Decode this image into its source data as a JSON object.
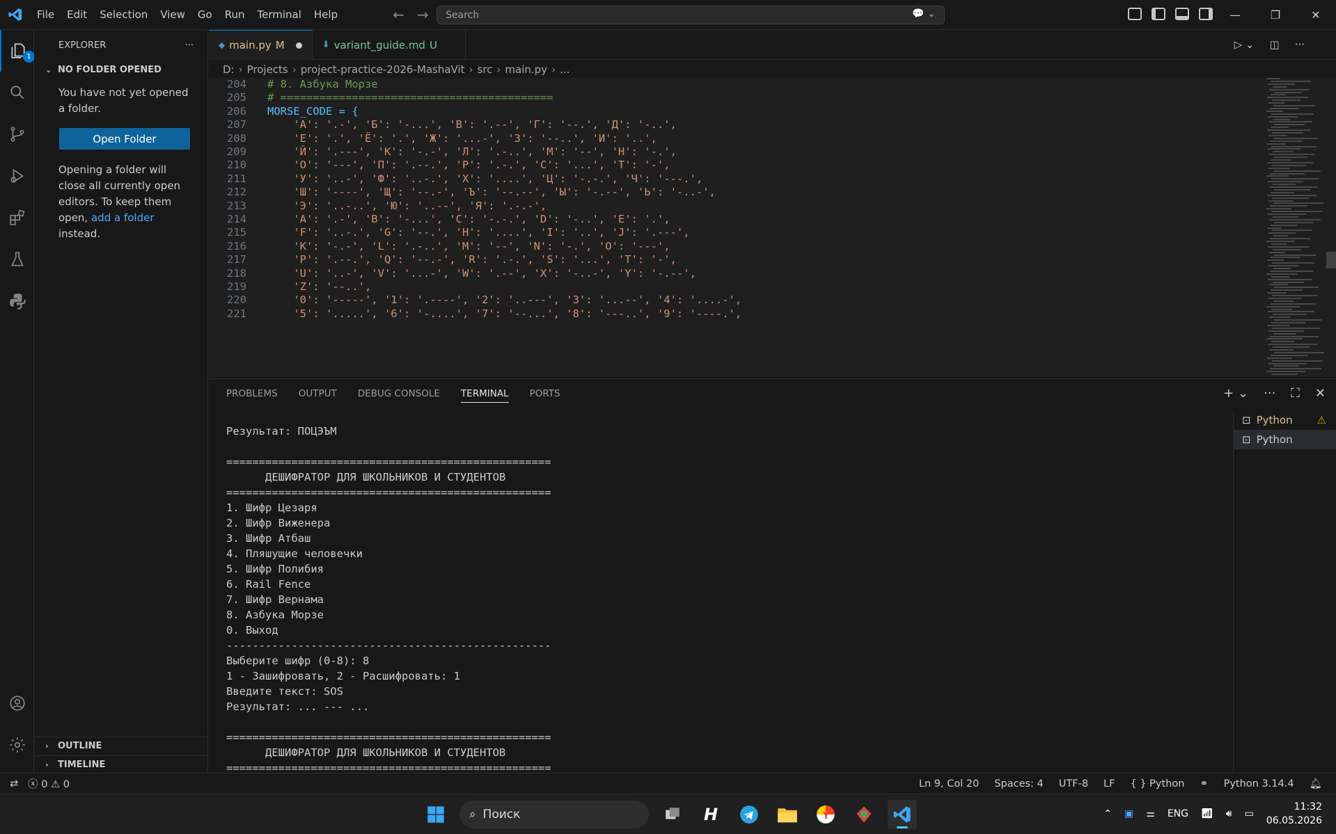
{
  "menu": [
    "File",
    "Edit",
    "Selection",
    "View",
    "Go",
    "Run",
    "Terminal",
    "Help"
  ],
  "search": {
    "placeholder": "Search"
  },
  "activity": {
    "explorer_badge": "1"
  },
  "sidebar": {
    "title": "EXPLORER",
    "section": "NO FOLDER OPENED",
    "message": "You have not yet opened a folder.",
    "open_folder": "Open Folder",
    "hint_1": "Opening a folder will close all currently open editors. To keep them open, ",
    "hint_link": "add a folder",
    "hint_2": " instead.",
    "outline": "OUTLINE",
    "timeline": "TIMELINE"
  },
  "tabs": [
    {
      "label": "main.py",
      "status": "M"
    },
    {
      "label": "variant_guide.md",
      "status": "U"
    }
  ],
  "breadcrumb": [
    "D:",
    "Projects",
    "project-practice-2026-MashaVit",
    "src",
    "main.py",
    "..."
  ],
  "code": [
    {
      "n": "204",
      "t": "# 8. Азбука Морзе",
      "k": "comment"
    },
    {
      "n": "205",
      "t": "# ==========================================",
      "k": "comment"
    },
    {
      "n": "206",
      "t": "MORSE_CODE = {",
      "k": "decl"
    },
    {
      "n": "207",
      "t": "    'А': '.-', 'Б': '-...', 'В': '.--', 'Г': '--.', 'Д': '-..',",
      "k": "str"
    },
    {
      "n": "208",
      "t": "    'Е': '.', 'Ё': '.', 'Ж': '...-', 'З': '--..', 'И': '..',",
      "k": "str"
    },
    {
      "n": "209",
      "t": "    'Й': '.---', 'К': '-.-', 'Л': '.-..', 'М': '--', 'Н': '-.',",
      "k": "str"
    },
    {
      "n": "210",
      "t": "    'О': '---', 'П': '.--.', 'Р': '.-.', 'С': '...', 'Т': '-',",
      "k": "str"
    },
    {
      "n": "211",
      "t": "    'У': '..-', 'Ф': '..-.', 'Х': '....', 'Ц': '-.-.', 'Ч': '---.',",
      "k": "str"
    },
    {
      "n": "212",
      "t": "    'Ш': '----', 'Щ': '--.-', 'Ъ': '--.--', 'Ы': '-.--', 'Ь': '-..-',",
      "k": "str"
    },
    {
      "n": "213",
      "t": "    'Э': '..-..', 'Ю': '..--', 'Я': '.-.-',",
      "k": "str"
    },
    {
      "n": "214",
      "t": "    'A': '.-', 'B': '-...', 'C': '-.-.', 'D': '-..', 'E': '.',",
      "k": "str"
    },
    {
      "n": "215",
      "t": "    'F': '..-.', 'G': '--.', 'H': '....', 'I': '..', 'J': '.---',",
      "k": "str"
    },
    {
      "n": "216",
      "t": "    'K': '-.-', 'L': '.-..', 'M': '--', 'N': '-.', 'O': '---',",
      "k": "str"
    },
    {
      "n": "217",
      "t": "    'P': '.--.', 'Q': '--.-', 'R': '.-.', 'S': '...', 'T': '-',",
      "k": "str"
    },
    {
      "n": "218",
      "t": "    'U': '..-', 'V': '...-', 'W': '.--', 'X': '-..-', 'Y': '-.--',",
      "k": "str"
    },
    {
      "n": "219",
      "t": "    'Z': '--..',",
      "k": "str"
    },
    {
      "n": "220",
      "t": "    '0': '-----', '1': '.----', '2': '..---', '3': '...--', '4': '....-',",
      "k": "str"
    },
    {
      "n": "221",
      "t": "    '5': '.....', '6': '-....', '7': '--...', '8': '---..', '9': '----.',",
      "k": "str"
    }
  ],
  "panel": {
    "tabs": [
      "PROBLEMS",
      "OUTPUT",
      "DEBUG CONSOLE",
      "TERMINAL",
      "PORTS"
    ],
    "active_tab": "TERMINAL",
    "terminals": [
      "Python",
      "Python"
    ]
  },
  "terminal_lines": [
    "Результат: ПОЦЭЪМ",
    "",
    "==================================================",
    "      ДЕШИФРАТОР ДЛЯ ШКОЛЬНИКОВ И СТУДЕНТОВ",
    "==================================================",
    "1. Шифр Цезаря",
    "2. Шифр Виженера",
    "3. Шифр Атбаш",
    "4. Пляшущие человечки",
    "5. Шифр Полибия",
    "6. Rail Fence",
    "7. Шифр Вернама",
    "8. Азбука Морзе",
    "0. Выход",
    "--------------------------------------------------",
    "Выберите шифр (0-8): 8",
    "1 - Зашифровать, 2 - Расшифровать: 1",
    "Введите текст: SOS",
    "Результат: ... --- ...",
    "",
    "==================================================",
    "      ДЕШИФРАТОР ДЛЯ ШКОЛЬНИКОВ И СТУДЕНТОВ",
    "=================================================="
  ],
  "status": {
    "errors": "0",
    "warnings": "0",
    "position": "Ln 9, Col 20",
    "spaces": "Spaces: 4",
    "encoding": "UTF-8",
    "eol": "LF",
    "language": "Python",
    "interpreter": "Python 3.14.4"
  },
  "taskbar": {
    "search": "Поиск",
    "lang": "ENG",
    "time": "11:32",
    "date": "06.05.2026"
  }
}
